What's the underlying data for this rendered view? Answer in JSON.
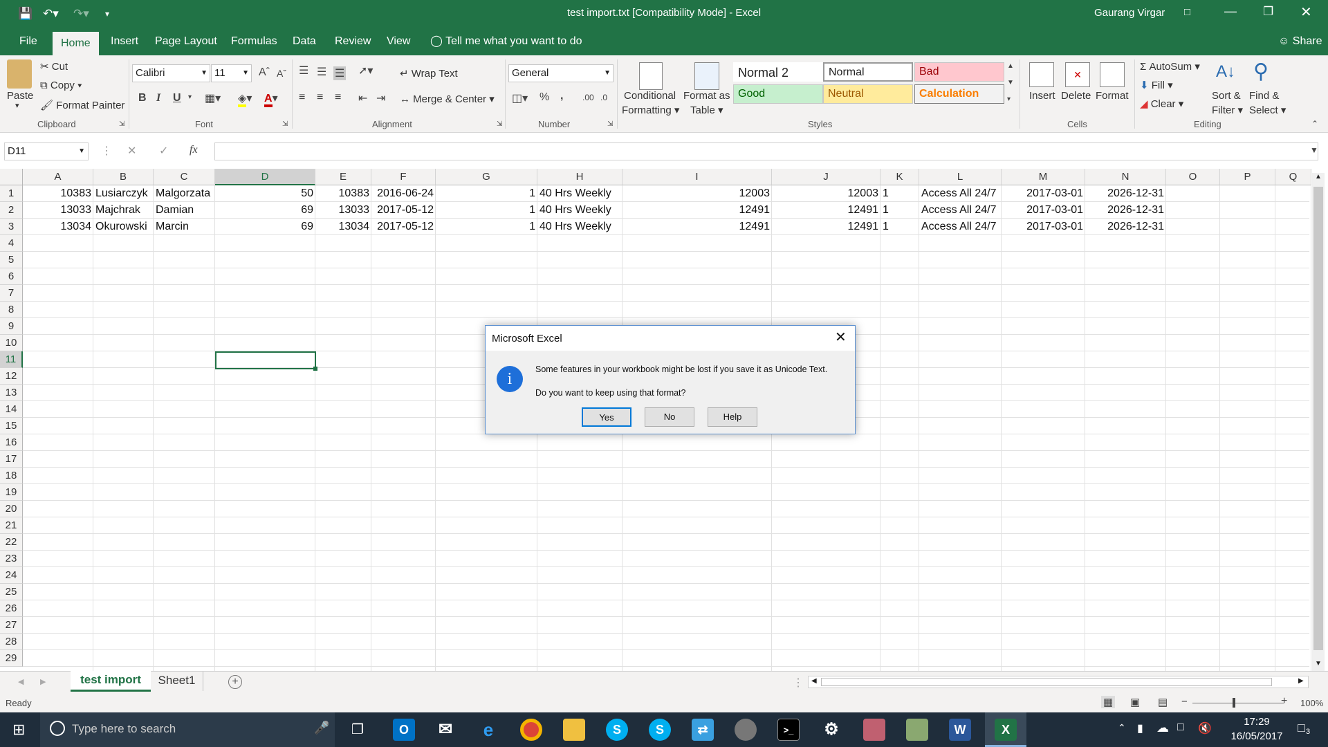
{
  "window": {
    "title": "test import.txt  [Compatibility Mode]  -  Excel",
    "user": "Gaurang Virgar"
  },
  "ribbon_tabs": [
    "File",
    "Home",
    "Insert",
    "Page Layout",
    "Formulas",
    "Data",
    "Review",
    "View"
  ],
  "tell_me": "Tell me what you want to do",
  "share": "Share",
  "clipboard": {
    "paste": "Paste",
    "cut": "Cut",
    "copy": "Copy",
    "format_painter": "Format Painter",
    "label": "Clipboard"
  },
  "font": {
    "name": "Calibri",
    "size": "11",
    "label": "Font"
  },
  "alignment": {
    "wrap": "Wrap Text",
    "merge": "Merge & Center",
    "label": "Alignment"
  },
  "number": {
    "format": "General",
    "label": "Number"
  },
  "styles": {
    "conditional_1": "Conditional",
    "conditional_2": "Formatting",
    "format_as_1": "Format as",
    "format_as_2": "Table",
    "normal2": "Normal 2",
    "normal": "Normal",
    "bad": "Bad",
    "good": "Good",
    "neutral": "Neutral",
    "calculation": "Calculation",
    "label": "Styles"
  },
  "cells_group": {
    "insert": "Insert",
    "delete": "Delete",
    "format": "Format",
    "label": "Cells"
  },
  "editing": {
    "autosum": "AutoSum",
    "fill": "Fill",
    "clear": "Clear",
    "sort_1": "Sort &",
    "sort_2": "Filter",
    "find_1": "Find &",
    "find_2": "Select",
    "label": "Editing"
  },
  "formula_bar": {
    "name_box": "D11",
    "fx": "fx",
    "value": ""
  },
  "columns": [
    "A",
    "B",
    "C",
    "D",
    "E",
    "F",
    "G",
    "H",
    "I",
    "J",
    "K",
    "L",
    "M",
    "N",
    "O",
    "P",
    "Q"
  ],
  "rows": [
    [
      "10383",
      "Lusiarczyk",
      "Malgorzata",
      "50",
      "10383",
      "2016-06-24",
      "1",
      "40 Hrs Weekly",
      "12003",
      "12003",
      "1",
      "Access All 24/7",
      "2017-03-01",
      "2026-12-31"
    ],
    [
      "13033",
      "Majchrak",
      "Damian",
      "69",
      "13033",
      "2017-05-12",
      "1",
      "40 Hrs Weekly",
      "12491",
      "12491",
      "1",
      "Access All 24/7",
      "2017-03-01",
      "2026-12-31"
    ],
    [
      "13034",
      "Okurowski",
      "Marcin",
      "69",
      "13034",
      "2017-05-12",
      "1",
      "40 Hrs Weekly",
      "12491",
      "12491",
      "1",
      "Access All 24/7",
      "2017-03-01",
      "2026-12-31"
    ]
  ],
  "row_numbers": [
    "1",
    "2",
    "3",
    "4",
    "5",
    "6",
    "7",
    "8",
    "9",
    "10",
    "11",
    "12",
    "13",
    "14",
    "15",
    "16",
    "17",
    "18",
    "19",
    "20",
    "21",
    "22",
    "23",
    "24",
    "25",
    "26",
    "27",
    "28",
    "29"
  ],
  "sheets": {
    "active": "test import",
    "other": "Sheet1"
  },
  "status": {
    "ready": "Ready",
    "zoom": "100%"
  },
  "dialog": {
    "title": "Microsoft Excel",
    "message": "Some features in your workbook might be lost if you save it as Unicode Text.",
    "question": "Do you want to keep using that format?",
    "yes": "Yes",
    "no": "No",
    "help": "Help"
  },
  "taskbar": {
    "search": "Type here to search",
    "time": "17:29",
    "date": "16/05/2017",
    "notifications": "3"
  },
  "colors": {
    "accent": "#217346",
    "bad_bg": "#ffc7ce",
    "good_bg": "#c6efce",
    "neutral_bg": "#ffeb9c",
    "calc_bg": "#f2f2f2"
  }
}
